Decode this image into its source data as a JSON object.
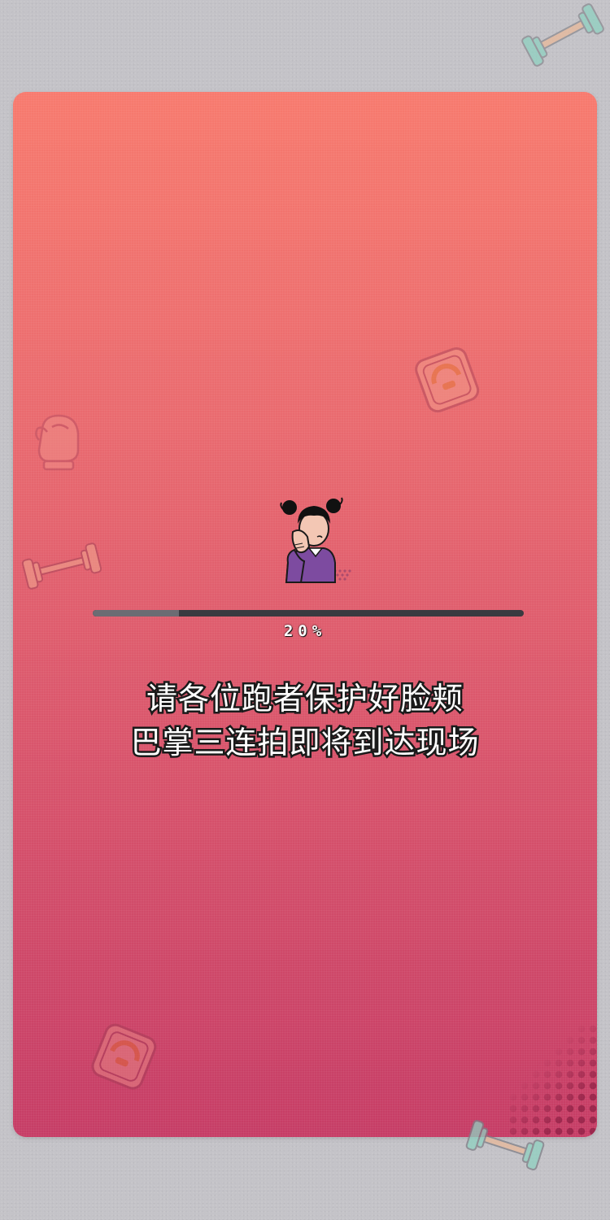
{
  "loading": {
    "progress_label": "20%",
    "progress_value": 0.2
  },
  "message": {
    "line1": "请各位跑者保护好脸颊",
    "line2": "巴掌三连拍即将到达现场"
  },
  "icons": [
    "dumbbell-icon",
    "scale-icon",
    "boxing-glove-icon",
    "girl-illustration"
  ],
  "colors": {
    "background": "#c4c3c8",
    "card_top": "#f77a6e",
    "card_bottom": "#c63d66",
    "progress_track": "#3a3a40",
    "progress_fill": "#6c6c73",
    "text": "#ffffff",
    "text_outline": "#1a1a1a"
  }
}
